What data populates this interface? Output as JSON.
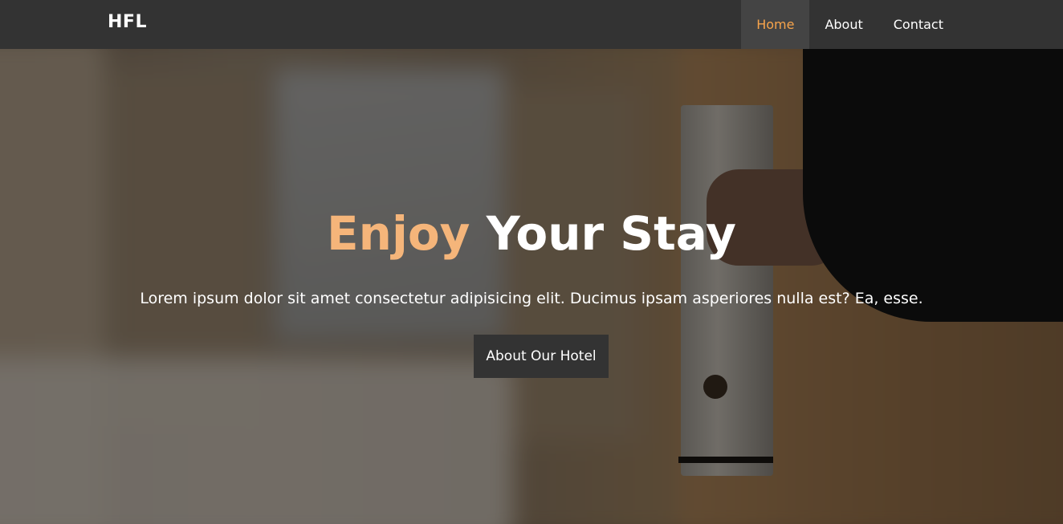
{
  "nav": {
    "brand": "HFL",
    "links": [
      {
        "label": "Home",
        "active": true
      },
      {
        "label": "About",
        "active": false
      },
      {
        "label": "Contact",
        "active": false
      }
    ]
  },
  "hero": {
    "title_accent": "Enjoy",
    "title_rest": "Your Stay",
    "subtitle": "Lorem ipsum dolor sit amet consectetur adipisicing elit. Ducimus ipsam asperiores nulla est? Ea, esse.",
    "cta_label": "About Our Hotel"
  },
  "colors": {
    "nav_bg": "#333333",
    "accent": "#f7a44b",
    "title_accent": "#f5b57a"
  }
}
